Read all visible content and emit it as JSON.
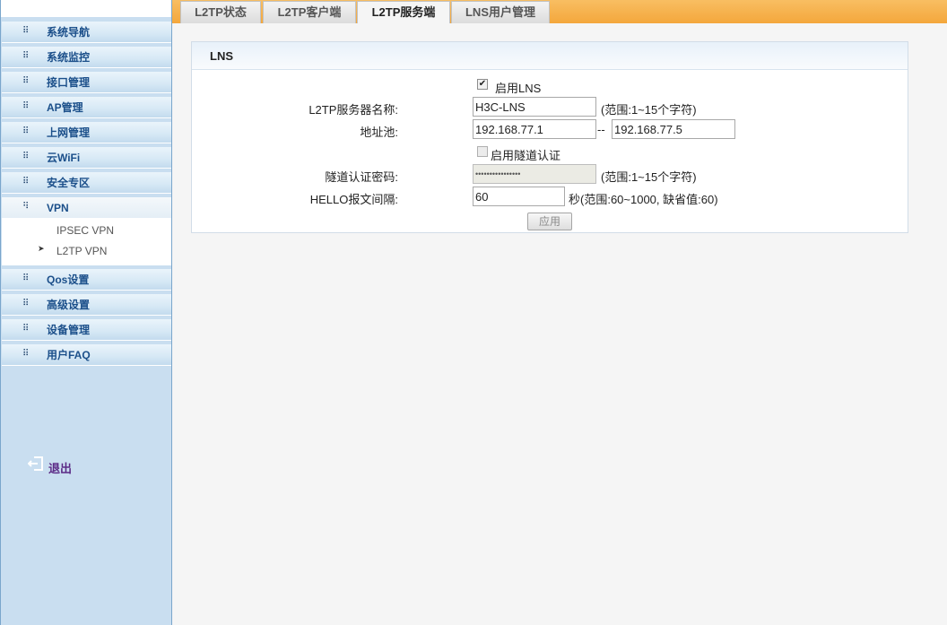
{
  "sidebar": {
    "menu": [
      {
        "label": "系统导航",
        "icon": "expand-arrows-icon"
      },
      {
        "label": "系统监控",
        "icon": "expand-arrows-icon"
      },
      {
        "label": "接口管理",
        "icon": "expand-arrows-icon"
      },
      {
        "label": "AP管理",
        "icon": "expand-arrows-icon"
      },
      {
        "label": "上网管理",
        "icon": "expand-arrows-icon"
      },
      {
        "label": "云WiFi",
        "icon": "expand-arrows-icon"
      },
      {
        "label": "安全专区",
        "icon": "expand-arrows-icon"
      },
      {
        "label": "VPN",
        "icon": "collapse-arrows-icon"
      },
      {
        "label": "Qos设置",
        "icon": "expand-arrows-icon"
      },
      {
        "label": "高级设置",
        "icon": "expand-arrows-icon"
      },
      {
        "label": "设备管理",
        "icon": "expand-arrows-icon"
      },
      {
        "label": "用户FAQ",
        "icon": "expand-arrows-icon"
      }
    ],
    "vpn_submenu": [
      {
        "label": "IPSEC VPN"
      },
      {
        "label": "L2TP VPN",
        "selected": true
      }
    ],
    "logout_label": "退出"
  },
  "tabs": [
    {
      "label": "L2TP状态"
    },
    {
      "label": "L2TP客户端"
    },
    {
      "label": "L2TP服务端",
      "active": true
    },
    {
      "label": "LNS用户管理"
    }
  ],
  "panel": {
    "title": "LNS",
    "enable_lns": {
      "label": "启用LNS",
      "checked": true
    },
    "server_name": {
      "label": "L2TP服务器名称:",
      "value": "H3C-LNS",
      "hint": "(范围:1~15个字符)"
    },
    "address_pool": {
      "label": "地址池:",
      "start": "192.168.77.1",
      "separator": "--",
      "end": "192.168.77.5"
    },
    "tunnel_auth": {
      "label": "启用隧道认证",
      "checked": false
    },
    "tunnel_password": {
      "label": "隧道认证密码:",
      "value": "••••••••••••••••",
      "hint": "(范围:1~15个字符)"
    },
    "hello_interval": {
      "label": "HELLO报文间隔:",
      "value": "60",
      "hint": "秒(范围:60~1000, 缺省值:60)"
    },
    "apply_label": "应用"
  },
  "colors": {
    "tabbar_accent": "#f4a73c",
    "sidebar_bg": "#c9def0",
    "menu_text": "#1b4f8a",
    "logout_text": "#5b2a86"
  }
}
